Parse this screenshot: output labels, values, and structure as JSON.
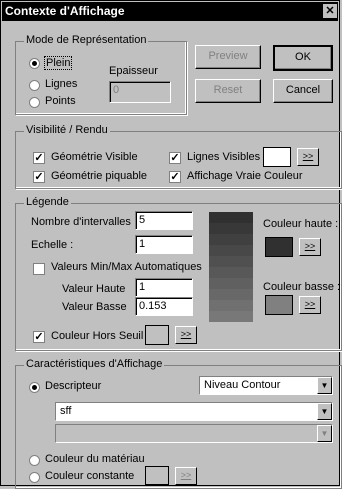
{
  "window": {
    "title": "Contexte d'Affichage",
    "close_glyph": "✕"
  },
  "mode": {
    "legend": "Mode de Représentation",
    "options": [
      "Plein",
      "Lignes",
      "Points"
    ],
    "selected": "Plein",
    "epaisseur_label": "Epaisseur",
    "epaisseur_value": "0"
  },
  "buttons": {
    "preview": "Preview",
    "ok": "OK",
    "reset": "Reset",
    "cancel": "Cancel",
    "more": ">>"
  },
  "visibilite": {
    "legend": "Visibilité / Rendu",
    "geometrie_visible": "Géométrie Visible",
    "lignes_visibles": "Lignes Visibles",
    "geometrie_piquable": "Géométrie piquable",
    "vraie_couleur": "Affichage Vraie Couleur",
    "check_glyph": "✓",
    "lines_color": "#ffffff"
  },
  "legende": {
    "legend": "Légende",
    "nb_intervalles_label": "Nombre d'intervalles",
    "nb_intervalles_value": "5",
    "echelle_label": "Echelle :",
    "echelle_value": "1",
    "minmax_label": "Valeurs Min/Max Automatiques",
    "haute_label": "Valeur Haute",
    "haute_value": "1",
    "basse_label": "Valeur Basse",
    "basse_value": "0.153",
    "couleur_haute_label": "Couleur haute :",
    "couleur_basse_label": "Couleur basse :",
    "hors_seuil_label": "Couleur Hors Seuil",
    "couleur_haute": "#303030",
    "couleur_basse": "#808080",
    "hors_seuil_color": "#c0c0c0",
    "ramp": [
      "#303030",
      "#383838",
      "#404040",
      "#484848",
      "#505050",
      "#585858",
      "#606060",
      "#686868",
      "#707070",
      "#787878"
    ]
  },
  "caracteristiques": {
    "legend": "Caractéristiques d'Affichage",
    "descripteur_label": "Descripteur",
    "niveau_select": "Niveau Contour",
    "descripteur_value": "sff",
    "second_value": "",
    "couleur_materiau": "Couleur du matériau",
    "couleur_constante": "Couleur constante",
    "arrow_glyph": "▼"
  }
}
